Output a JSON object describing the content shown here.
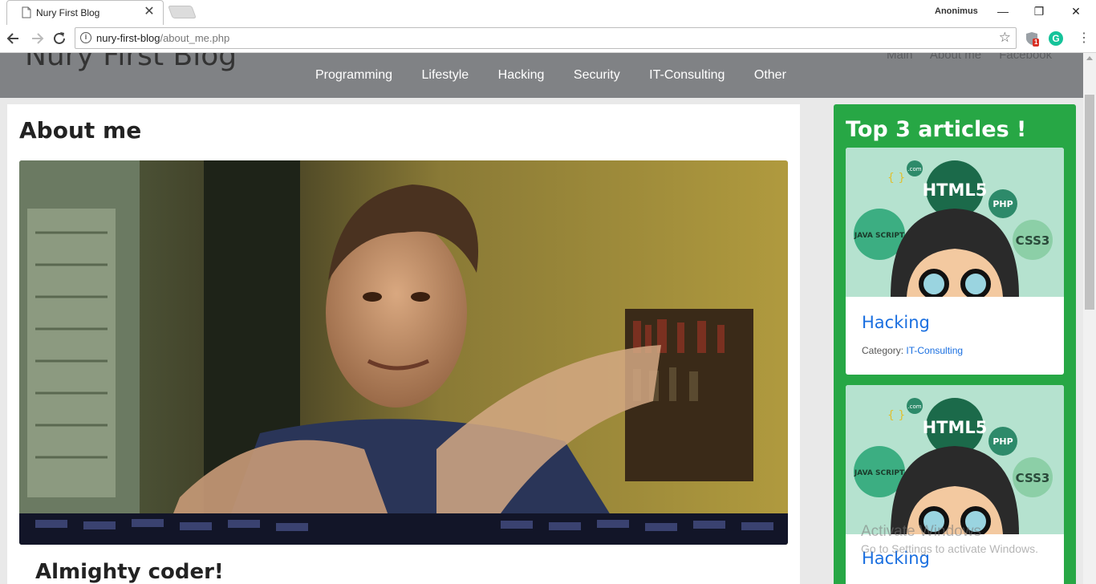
{
  "browser": {
    "tab_title": "Nury First Blog",
    "tab_close": "✕",
    "profile_name": "Anonimus",
    "window_controls": {
      "minimize": "—",
      "restore": "❐",
      "close": "✕"
    },
    "url_host": "nury-first-blog",
    "url_path": "/about_me.php",
    "extension_badge": "1",
    "grammarly_letter": "G"
  },
  "site": {
    "title": "Nury First Blog",
    "top_nav": [
      "Main",
      "About me",
      "Facebook"
    ],
    "main_nav": [
      "Programming",
      "Lifestyle",
      "Hacking",
      "Security",
      "IT-Consulting",
      "Other"
    ]
  },
  "main": {
    "heading": "About me",
    "subheading": "Almighty coder!"
  },
  "sidebar": {
    "heading": "Top 3 articles !",
    "cards": [
      {
        "thumb_labels": [
          "HTML5",
          "PHP",
          "CSS3",
          "JAVA SCRIPT",
          ".com",
          "{ }"
        ],
        "title": "Hacking",
        "category_label": "Category:",
        "category": "IT-Consulting"
      },
      {
        "thumb_labels": [
          "HTML5",
          "PHP",
          "CSS3",
          "JAVA SCRIPT",
          ".com",
          "{ }"
        ],
        "title": "Hacking",
        "category_label": "",
        "category": ""
      }
    ]
  },
  "watermark": {
    "line1": "Activate Windows",
    "line2": "Go to Settings to activate Windows."
  },
  "icons": [
    "page-favicon",
    "back-arrow-icon",
    "forward-arrow-icon",
    "reload-icon",
    "info-icon",
    "star-icon",
    "extension-shield-icon",
    "grammarly-icon",
    "menu-dots-icon"
  ]
}
